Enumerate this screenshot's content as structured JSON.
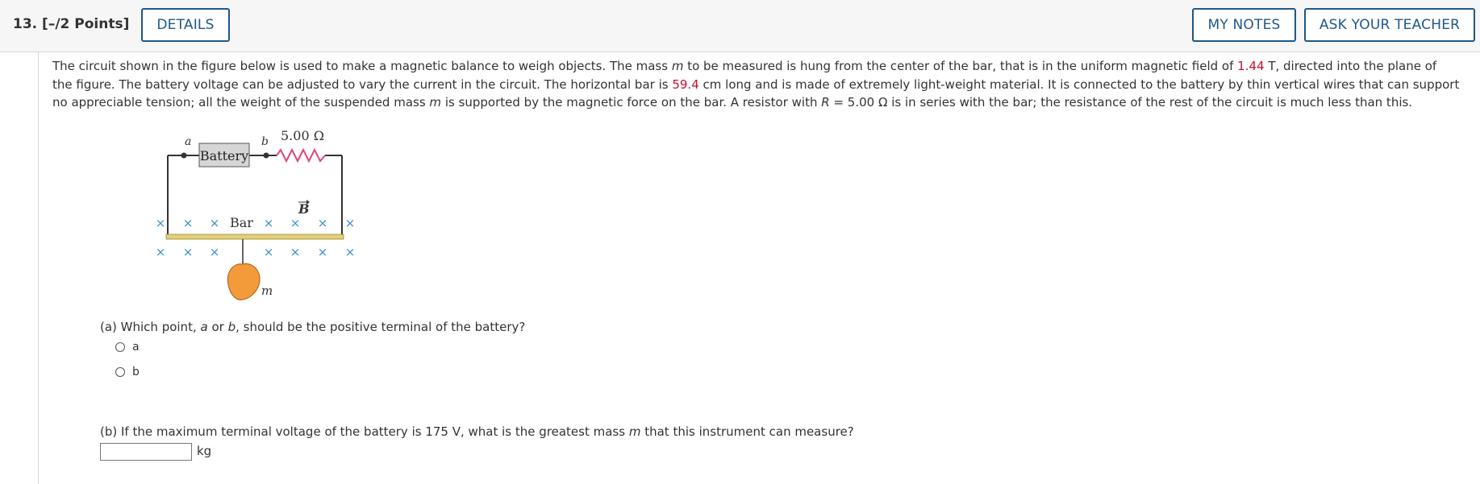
{
  "header": {
    "question_number": "13.",
    "points": "[–/2 Points]",
    "details_label": "DETAILS",
    "my_notes_label": "MY NOTES",
    "ask_teacher_label": "ASK YOUR TEACHER"
  },
  "problem": {
    "text_1": "The circuit shown in the figure below is used to make a magnetic balance to weigh objects. The mass ",
    "var_m": "m",
    "text_2": " to be measured is hung from the center of the bar, that is in the uniform magnetic field of ",
    "field_value": "1.44",
    "text_3": " T, directed into the plane of the figure. The battery voltage can be adjusted to vary the current in the circuit. The horizontal bar is ",
    "bar_length": "59.4",
    "text_4": " cm long and is made of extremely light-weight material. It is connected to the battery by thin vertical wires that can support no appreciable tension; all the weight of the suspended mass ",
    "var_m2": "m",
    "text_5": " is supported by the magnetic force on the bar. A resistor with ",
    "var_R": "R",
    "text_6": " = 5.00 Ω is in series with the bar; the resistance of the rest of the circuit is much less than this."
  },
  "figure": {
    "label_a": "a",
    "label_b": "b",
    "battery_label": "Battery",
    "resistor_label": "5.00 Ω",
    "field_label": "B",
    "bar_label": "Bar",
    "mass_label": "m",
    "field_symbol": "×"
  },
  "part_a": {
    "prefix": "(a) Which point, ",
    "a": "a",
    "mid": " or ",
    "b": "b",
    "suffix": ", should be the positive terminal of the battery?",
    "options": [
      "a",
      "b"
    ]
  },
  "part_b": {
    "prefix": "(b) If the maximum terminal voltage of the battery is 175 V, what is the greatest mass ",
    "var_m": "m",
    "suffix": " that this instrument can measure?",
    "input_value": "",
    "unit": "kg"
  },
  "colors": {
    "accent": "#1f5788",
    "highlight": "#c8102e",
    "field_x": "#3a8fd1",
    "resistor": "#e0457b",
    "bar": "#e2cf7a",
    "mass": "#f39a3a"
  }
}
